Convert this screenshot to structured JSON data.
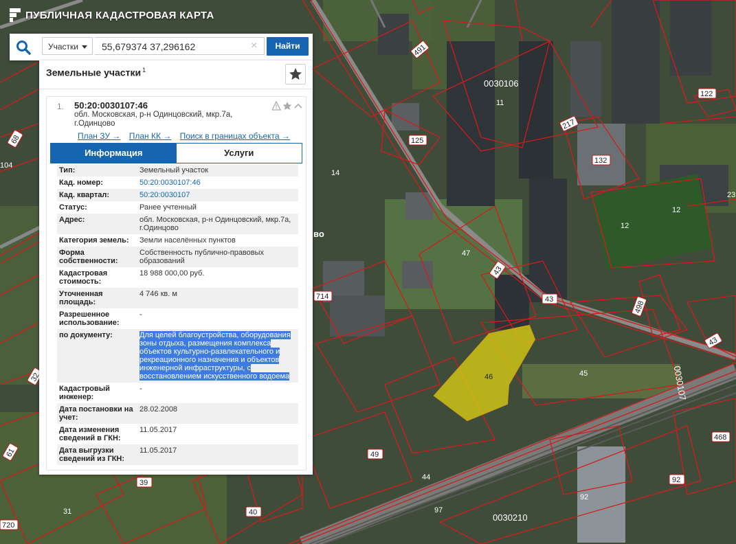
{
  "app": {
    "title": "ПУБЛИЧНАЯ КАДАСТРОВАЯ КАРТА"
  },
  "search": {
    "type_label": "Участки",
    "query": "55,679374 37,296162",
    "button_label": "Найти",
    "clear_glyph": "×"
  },
  "panel": {
    "title": "Земельные участки",
    "count": "1",
    "result": {
      "index": "1.",
      "cadastral_number": "50:20:0030107:46",
      "address": "обл. Московская, р-н Одинцовский, мкр.7а, г.Одинцово",
      "links": [
        "План ЗУ →",
        "План КК →",
        "Поиск в границах объекта →"
      ],
      "tabs": [
        {
          "label": "Информация",
          "active": true
        },
        {
          "label": "Услуги",
          "active": false
        }
      ],
      "rows": [
        {
          "key": "Тип:",
          "value": "Земельный участок"
        },
        {
          "key": "Кад. номер:",
          "value": "50:20:0030107:46",
          "link": true
        },
        {
          "key": "Кад. квартал:",
          "value": "50:20:0030107",
          "link": true
        },
        {
          "key": "Статус:",
          "value": "Ранее учтенный"
        },
        {
          "key": "Адрес:",
          "value": "обл. Московская, р-н Одинцовский, мкр.7а, г.Одинцово"
        },
        {
          "key": "Категория земель:",
          "value": "Земли населённых пунктов"
        },
        {
          "key": "Форма собственности:",
          "value": "Собственность публично-правовых образований"
        },
        {
          "key": "Кадастровая стоимость:",
          "value": "18 988 000,00 руб."
        },
        {
          "key": "Уточненная площадь:",
          "value": "4 746 кв. м"
        },
        {
          "key": "Разрешенное использование:",
          "value": "-"
        },
        {
          "key": "по документу:",
          "value": "Для целей благоустройства, оборудования зоны отдыха, размещения комплекса объектов культурно-развлекательного и рекреационного назначения и объектов инженерной инфраструктуры, с восстановлением искусственного водоема",
          "highlight": true
        },
        {
          "key": "Кадастровый инженер:",
          "value": "-"
        },
        {
          "key": "Дата постановки на учет:",
          "value": "28.02.2008"
        },
        {
          "key": "Дата изменения сведений в ГКН:",
          "value": "11.05.2017"
        },
        {
          "key": "Дата выгрузки сведений из ГКН:",
          "value": "11.05.2017"
        }
      ]
    }
  },
  "map": {
    "selected_parcel_label": "46",
    "quarter_labels": [
      "0030106",
      "0030107",
      "0030210"
    ],
    "parcel_labels": [
      "491",
      "11",
      "217",
      "122",
      "125",
      "132",
      "14",
      "12",
      "12",
      "23",
      "47",
      "43",
      "43",
      "714",
      "498",
      "43",
      "45",
      "49",
      "44",
      "39",
      "31",
      "40",
      "97",
      "92",
      "92",
      "468",
      "61",
      "32",
      "720",
      "68",
      "104",
      "во"
    ],
    "colors": {
      "boundary": "#d21c1c",
      "selected_fill": "#d8d014",
      "accent": "#1565b0"
    }
  }
}
